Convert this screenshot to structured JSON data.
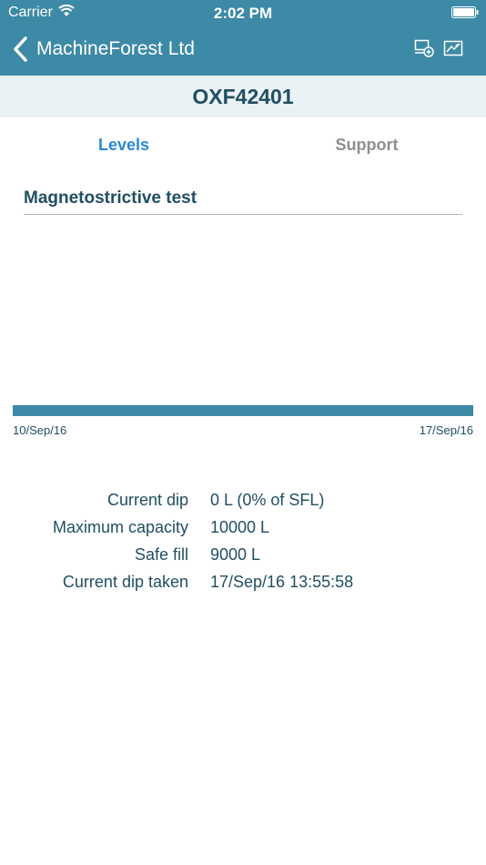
{
  "status_bar": {
    "carrier": "Carrier",
    "time": "2:02 PM"
  },
  "nav": {
    "back_label": "MachineForest Ltd",
    "icons": [
      "monitor-add-icon",
      "map-icon"
    ]
  },
  "header": {
    "title": "OXF42401"
  },
  "tabs": [
    {
      "label": "Levels",
      "active": true
    },
    {
      "label": "Support",
      "active": false
    }
  ],
  "section": {
    "title": "Magnetostrictive test"
  },
  "chart_data": {
    "type": "area",
    "x_start": "10/Sep/16",
    "x_end": "17/Sep/16",
    "values": []
  },
  "info": [
    {
      "label": "Current dip",
      "value": "0 L (0% of SFL)"
    },
    {
      "label": "Maximum capacity",
      "value": "10000 L"
    },
    {
      "label": "Safe fill",
      "value": "9000 L"
    },
    {
      "label": "Current dip taken",
      "value": "17/Sep/16 13:55:58"
    }
  ],
  "colors": {
    "brand": "#3d8aa6",
    "header_bg": "#eaf2f5",
    "text_dark": "#214f63",
    "tab_active": "#2a89d6",
    "tab_inactive": "#8f8f8f"
  }
}
